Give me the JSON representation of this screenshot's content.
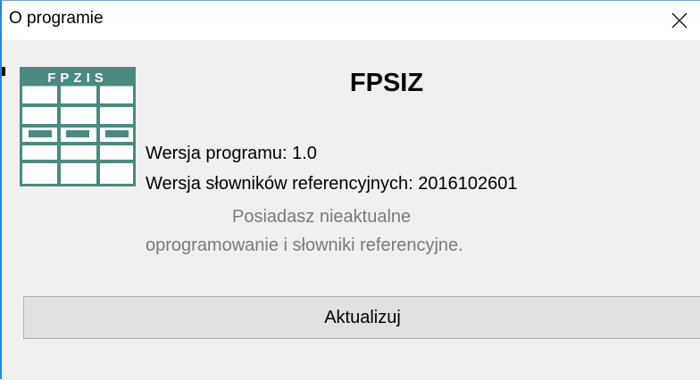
{
  "window": {
    "title": "O programie",
    "close_icon": "close-icon"
  },
  "app": {
    "logo_label": "FPZIS",
    "logo_icon": "table-grid-icon",
    "logo_color": "#4a8a80",
    "title": "FPSIZ"
  },
  "info": {
    "program_version": "Wersja programu: 1.0",
    "dictionary_version": "Wersja słowników referencyjnych: 2016102601",
    "status_line1": "Posiadasz nieaktualne",
    "status_line2": "oprogramowanie i słowniki referencyjne."
  },
  "actions": {
    "update_label": "Aktualizuj"
  }
}
